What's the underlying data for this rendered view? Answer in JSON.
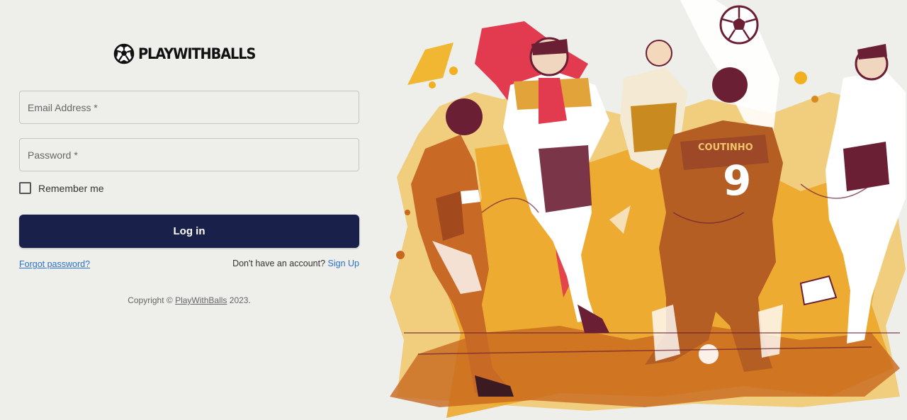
{
  "brand": {
    "name": "PLAYWITHBALLS",
    "logo_icon": "soccer-ball-icon"
  },
  "form": {
    "email_label": "Email Address *",
    "password_label": "Password *",
    "remember_label": "Remember me",
    "remember_checked": false,
    "login_label": "Log in",
    "forgot_label": "Forgot password?",
    "no_account_text": "Don't have an account?",
    "signup_label": "Sign Up"
  },
  "footer": {
    "copyright_prefix": "Copyright ©",
    "brand_link": "PlayWithBalls",
    "year_suffix": "2023."
  },
  "illustration": {
    "jersey_number": "9",
    "jersey_lettering": "COUTINHO"
  },
  "colors": {
    "primary_button": "#19204a",
    "link": "#2c72c8",
    "background": "#eeeeeb",
    "paint_red": "#e23a4e",
    "paint_yellow": "#f0b21f",
    "paint_orange": "#c8681e",
    "ink": "#6b1f34"
  }
}
